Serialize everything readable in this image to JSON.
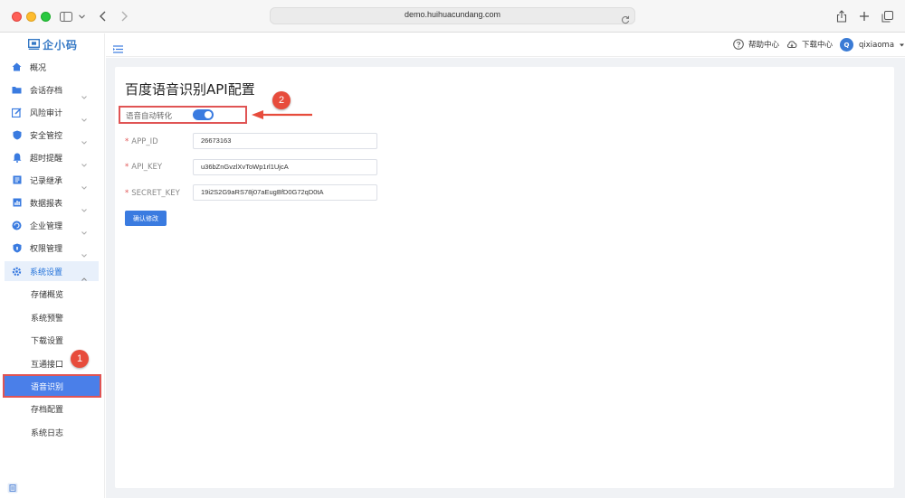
{
  "browser": {
    "url": "demo.huihuacundang.com"
  },
  "app": {
    "logo_text": "企小码"
  },
  "sidebar": {
    "items": [
      {
        "label": "概况",
        "icon": "home-icon",
        "has_chevron": false
      },
      {
        "label": "会话存档",
        "icon": "folder-icon",
        "has_chevron": true
      },
      {
        "label": "风险审计",
        "icon": "edit-icon",
        "has_chevron": true
      },
      {
        "label": "安全管控",
        "icon": "shield-icon",
        "has_chevron": true
      },
      {
        "label": "超时提醒",
        "icon": "bell-icon",
        "has_chevron": true
      },
      {
        "label": "记录继承",
        "icon": "list-icon",
        "has_chevron": true
      },
      {
        "label": "数据报表",
        "icon": "chart-icon",
        "has_chevron": true
      },
      {
        "label": "企业管理",
        "icon": "refresh-icon",
        "has_chevron": true
      },
      {
        "label": "权限管理",
        "icon": "lock-shield-icon",
        "has_chevron": true
      },
      {
        "label": "系统设置",
        "icon": "gear-icon",
        "has_chevron": true,
        "expanded": true
      }
    ],
    "sub_items": [
      {
        "label": "存储概览"
      },
      {
        "label": "系统预警"
      },
      {
        "label": "下载设置"
      },
      {
        "label": "互通接口"
      },
      {
        "label": "语音识别",
        "active": true
      },
      {
        "label": "存档配置"
      },
      {
        "label": "系统日志"
      }
    ]
  },
  "header": {
    "help_label": "帮助中心",
    "download_label": "下载中心",
    "avatar_letter": "Q",
    "username": "qixiaoma"
  },
  "main": {
    "title": "百度语音识别API配置",
    "auto_convert_label": "语音自动转化",
    "auto_convert_on": true,
    "fields": [
      {
        "label": "APP_ID",
        "value": "26673163",
        "required": true
      },
      {
        "label": "API_KEY",
        "value": "u36bZnGvzlXvToWp1rl1UjcA",
        "required": true
      },
      {
        "label": "SECRET_KEY",
        "value": "19i2S2G9aRS78j07aEugBfD0G72qD0tA",
        "required": true
      }
    ],
    "confirm_label": "确认修改"
  },
  "annotations": {
    "badge_1": "1",
    "badge_2": "2"
  },
  "colors": {
    "accent": "#3a7be0",
    "active_menu": "#4a7fe9",
    "annotation_red": "#e74c3c"
  }
}
